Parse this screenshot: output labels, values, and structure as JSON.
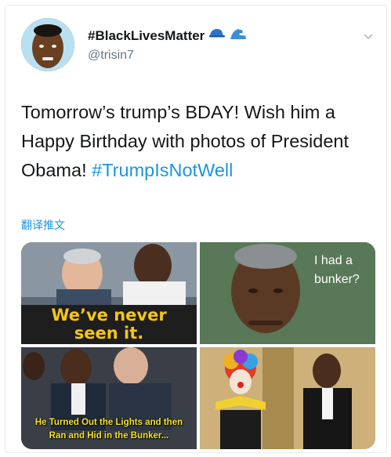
{
  "tweet": {
    "display_name": "#BlackLivesMatter",
    "handle": "@trisin7",
    "text_main": "Tomorrow’s trump’s BDAY! Wish him a Happy Birthday with photos of President Obama! ",
    "hashtag": "#TrumpIsNotWell",
    "translate_label": "翻译推文"
  },
  "icons": {
    "name_emoji_1": "blue-cap-icon",
    "name_emoji_2": "wave-icon",
    "menu": "chevron-down-icon"
  },
  "images": {
    "img1_caption_line1": "We’ve never",
    "img1_caption_line2": "seen it.",
    "img2_caption_line1": "I had a",
    "img2_caption_line2": "bunker?",
    "img3_caption_line1": "He Turned Out the Lights and then",
    "img3_caption_line2": "Ran and Hid in the Bunker..."
  },
  "colors": {
    "link": "#1b95e0",
    "text": "#14171a",
    "secondary": "#657786",
    "meme_caption_yellow": "#f5c518"
  }
}
